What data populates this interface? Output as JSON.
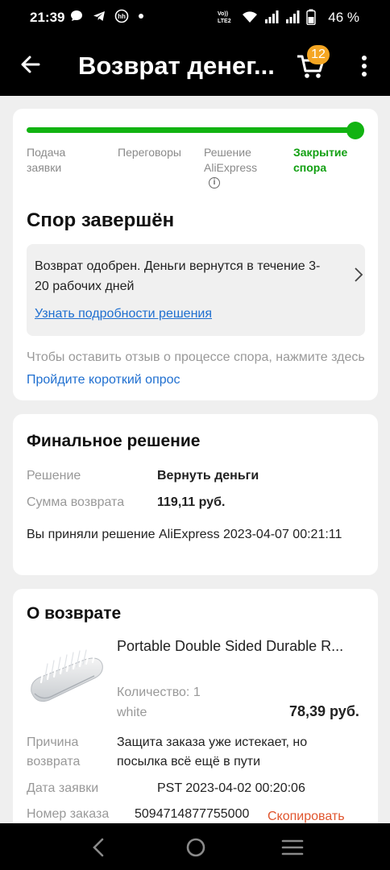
{
  "status_bar": {
    "time": "21:39",
    "battery_percent": "46 %",
    "net_label": "VoLTE2"
  },
  "app_bar": {
    "title": "Возврат денег...",
    "cart_count": "12"
  },
  "dispute_card": {
    "steps": [
      {
        "label_line1": "Подача",
        "label_line2": "заявки"
      },
      {
        "label_line1": "Переговоры",
        "label_line2": ""
      },
      {
        "label_line1": "Решение",
        "label_line2": "AliExpress"
      },
      {
        "label_line1": "Закрытие",
        "label_line2": "спора"
      }
    ],
    "progress": 1.0,
    "title": "Спор завершён",
    "notice_text": "Возврат одобрен. Деньги вернутся в течение 3-20 рабочих дней",
    "notice_link": "Узнать подробности решения",
    "survey_prefix": "Чтобы оставить отзыв о процессе спора, нажмите здесь ",
    "survey_link": "Пройдите короткий опрос"
  },
  "final_decision": {
    "title": "Финальное решение",
    "decision_label": "Решение",
    "decision_value": "Вернуть деньги",
    "amount_label": "Сумма возврата",
    "amount_value": "119,11 руб.",
    "accepted_text": "Вы приняли решение AliExpress 2023-04-07 00:21:11"
  },
  "refund_info": {
    "title": "О возврате",
    "product_title": "Portable Double Sided Durable R...",
    "quantity_text": "Количество: 1",
    "variant": "white",
    "price": "78,39 руб.",
    "reason_label_line1": "Причина",
    "reason_label_line2": "возврата",
    "reason_value": "Защита заказа уже истекает, но посылка всё ещё в пути",
    "date_label": "Дата заявки",
    "date_value": "PST 2023-04-02 00:20:06",
    "order_label": "Номер заказа",
    "order_value": "5094714877755000",
    "copy_label": "Скопировать"
  },
  "colors": {
    "accent_green": "#12b312",
    "link_blue": "#1f6fd0",
    "copy_orange": "#e0552e",
    "badge_orange": "#f5a623"
  }
}
